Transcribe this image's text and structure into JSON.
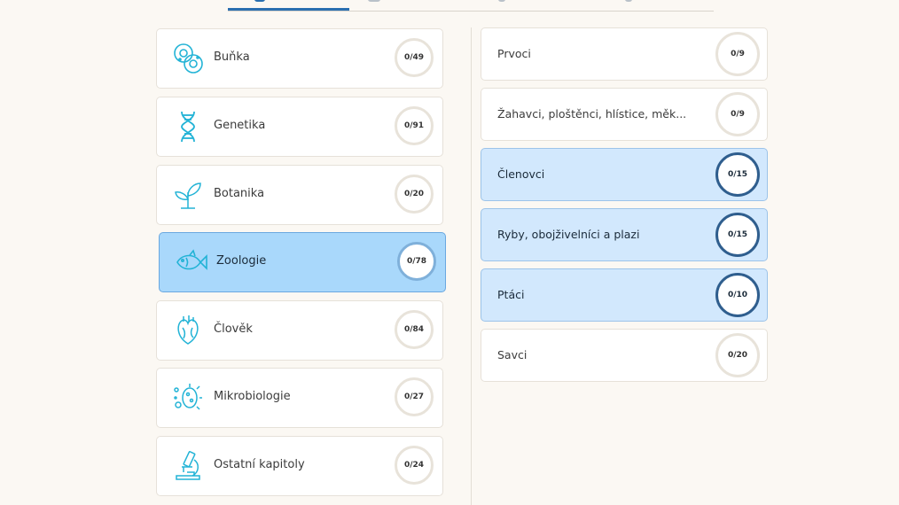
{
  "categories": [
    {
      "label": "Buňka",
      "progress": "0/49",
      "icon": "cell-icon"
    },
    {
      "label": "Genetika",
      "progress": "0/91",
      "icon": "dna-icon"
    },
    {
      "label": "Botanika",
      "progress": "0/20",
      "icon": "sprout-icon"
    },
    {
      "label": "Zoologie",
      "progress": "0/78",
      "icon": "fish-icon",
      "selected": true
    },
    {
      "label": "Člověk",
      "progress": "0/84",
      "icon": "human-heart-icon"
    },
    {
      "label": "Mikrobiologie",
      "progress": "0/27",
      "icon": "microbe-icon"
    },
    {
      "label": "Ostatní kapitoly",
      "progress": "0/24",
      "icon": "microscope-icon"
    }
  ],
  "subcategories": [
    {
      "label": "Prvoci",
      "progress": "0/9"
    },
    {
      "label": "Žahavci, ploštěnci, hlístice, měk...",
      "progress": "0/9"
    },
    {
      "label": "Členovci",
      "progress": "0/15",
      "highlighted": true
    },
    {
      "label": "Ryby, obojživelníci a plazi",
      "progress": "0/15",
      "highlighted": true
    },
    {
      "label": "Ptáci",
      "progress": "0/10",
      "highlighted": true
    },
    {
      "label": "Savci",
      "progress": "0/20"
    }
  ],
  "colors": {
    "background": "#fbf8f3",
    "accent_icon": "#22b3d6",
    "selected_card": "#a9d8fb",
    "highlight_card": "#d2e8fd",
    "ring_dark": "#2f5e8e"
  }
}
